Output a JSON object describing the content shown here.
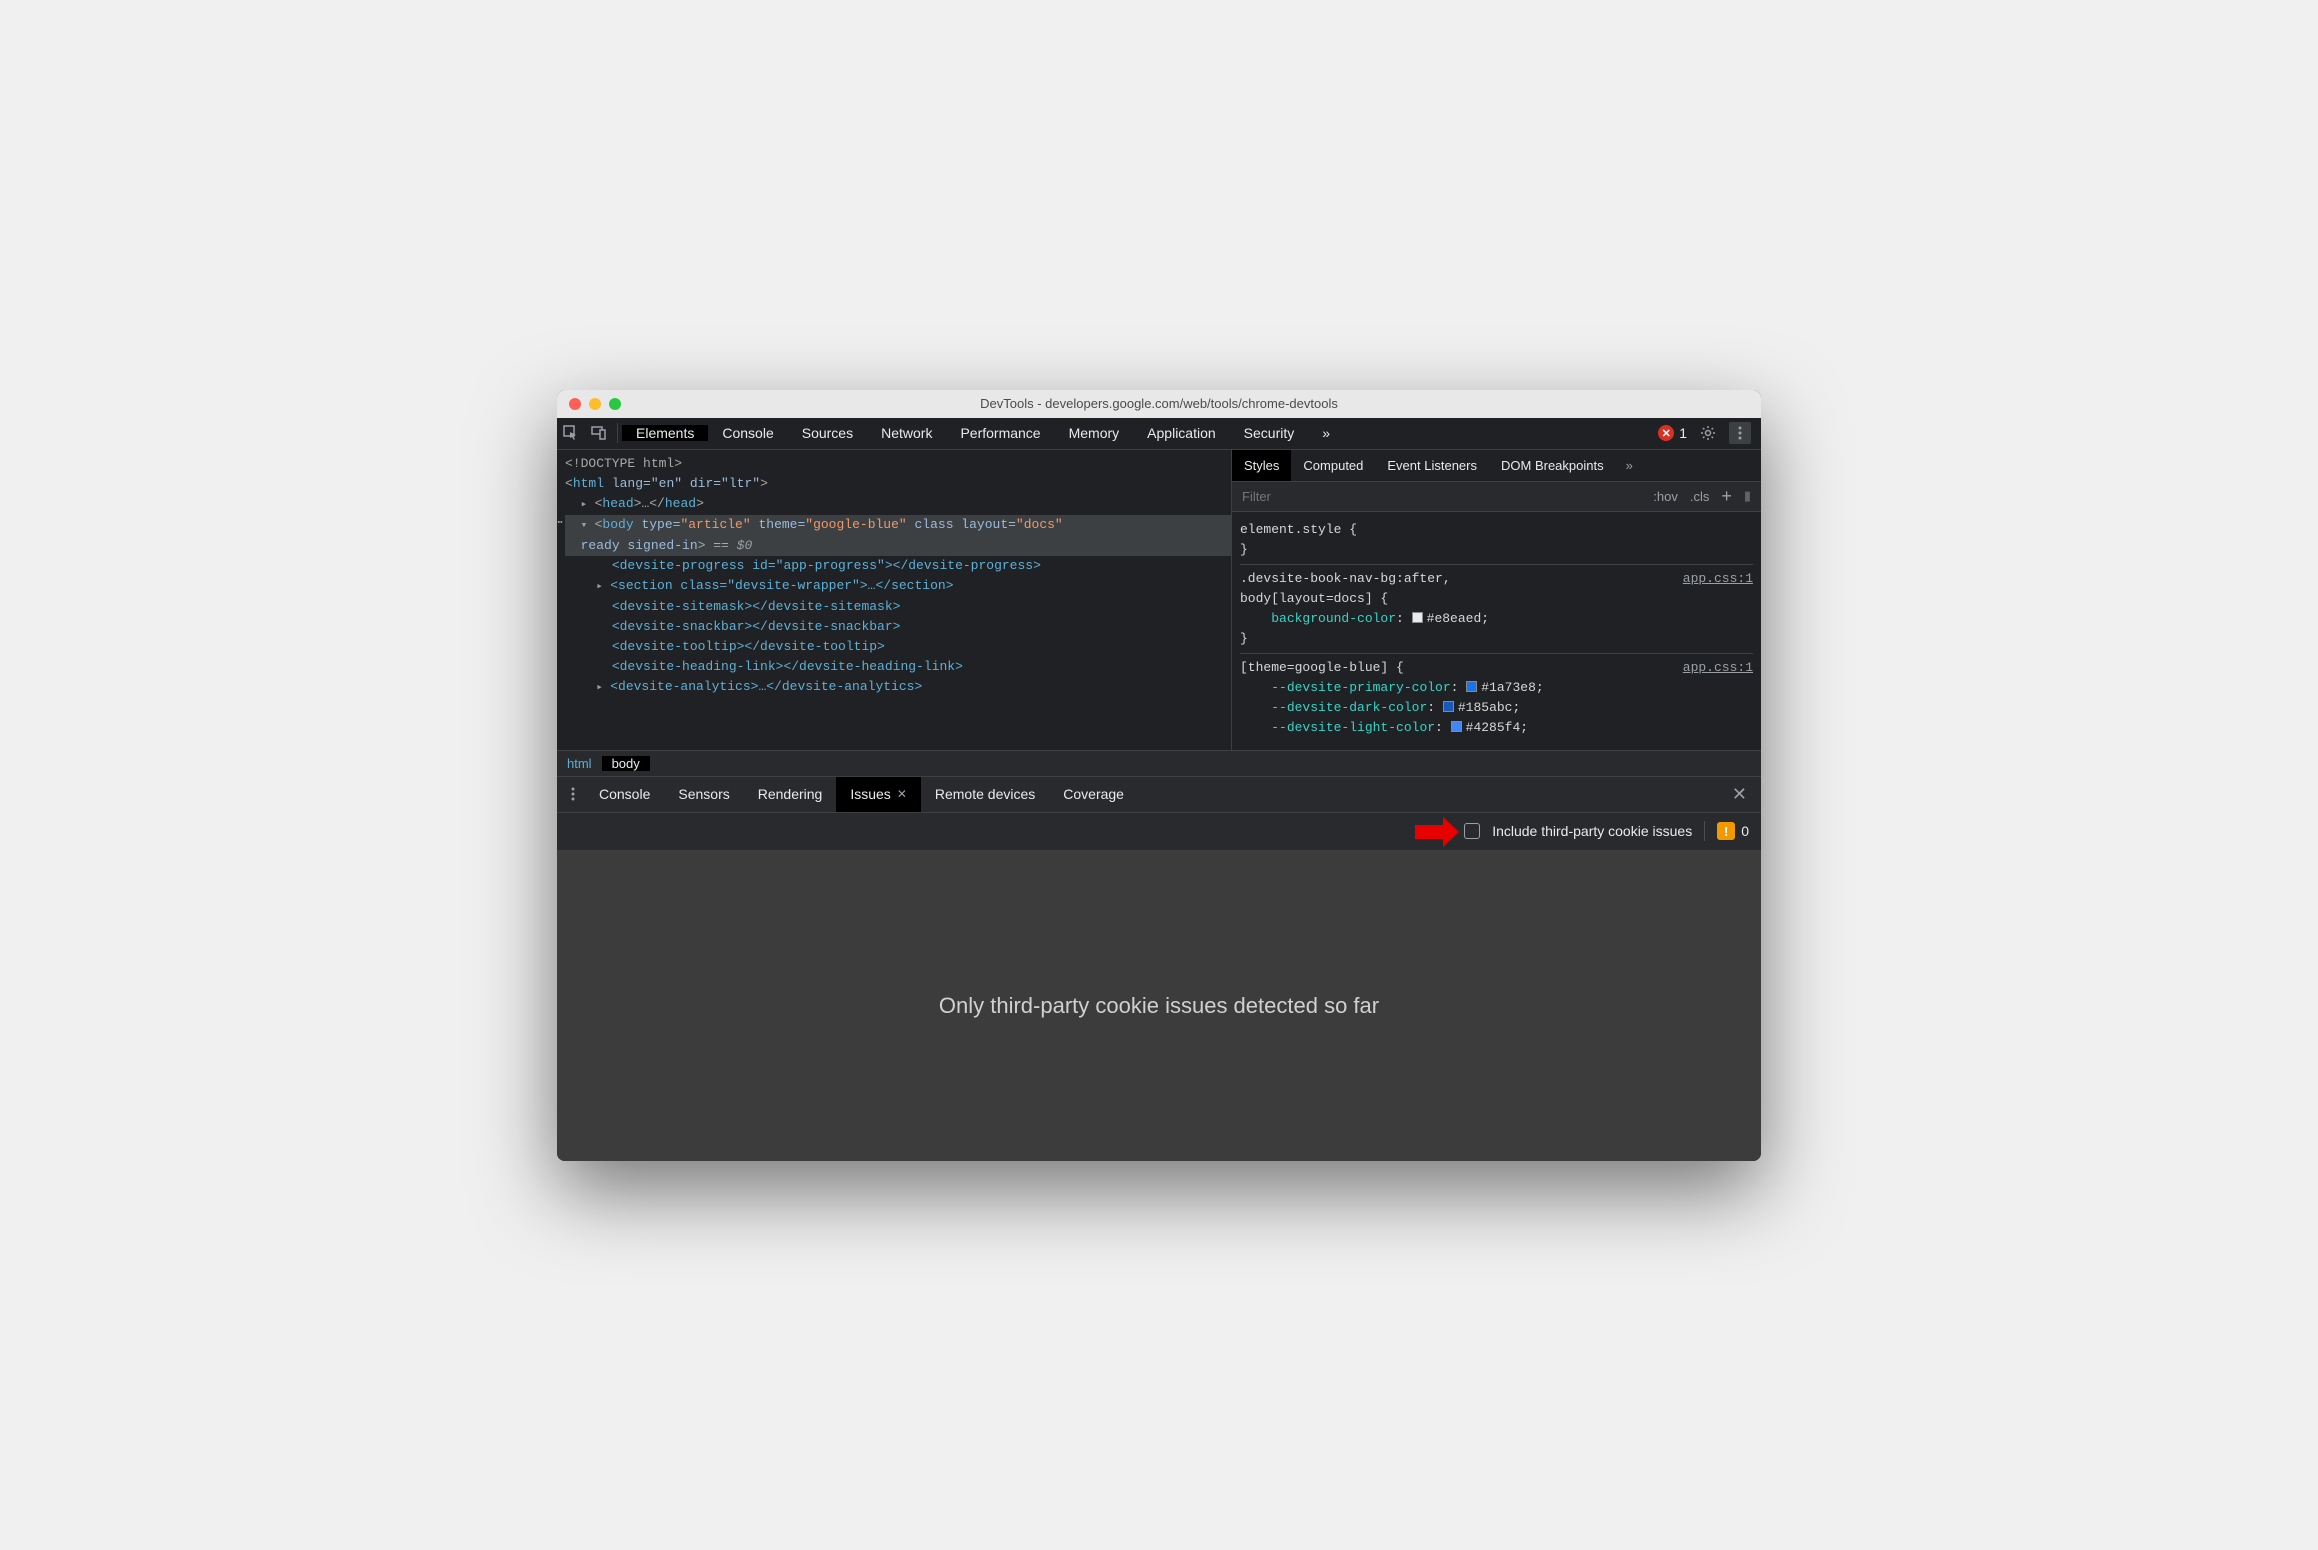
{
  "window": {
    "title": "DevTools - developers.google.com/web/tools/chrome-devtools"
  },
  "topbar": {
    "tabs": [
      "Elements",
      "Console",
      "Sources",
      "Network",
      "Performance",
      "Memory",
      "Application",
      "Security"
    ],
    "active": "Elements",
    "more_symbol": "»",
    "error_count": "1"
  },
  "elements": {
    "line0": "<!DOCTYPE html>",
    "line1_open": "<",
    "line1_tag": "html",
    "line1_attrs": " lang=\"en\" dir=\"ltr\"",
    "line1_close": ">",
    "line2_open": "<",
    "line2_tag": "head",
    "line2_mid": ">…</",
    "line2_tag2": "head",
    "line2_close": ">",
    "body_open": "<",
    "body_tag": "body",
    "body_attr1_name": " type=",
    "body_attr1_val": "\"article\"",
    "body_attr2_name": " theme=",
    "body_attr2_val": "\"google-blue\"",
    "body_attr3": " class layout=",
    "body_attr3_val": "\"docs\"",
    "body_line2": " ready signed-in",
    "body_eq": "> == ",
    "body_dollar": "$0",
    "child1": "<devsite-progress id=\"app-progress\"></devsite-progress>",
    "child2": "<section class=\"devsite-wrapper\">…</section>",
    "child3": "<devsite-sitemask></devsite-sitemask>",
    "child4": "<devsite-snackbar></devsite-snackbar>",
    "child5": "<devsite-tooltip></devsite-tooltip>",
    "child6": "<devsite-heading-link></devsite-heading-link>",
    "child7": "<devsite-analytics>…</devsite-analytics>"
  },
  "breadcrumb": {
    "items": [
      "html",
      "body"
    ],
    "active": "body"
  },
  "sidebar": {
    "tabs": [
      "Styles",
      "Computed",
      "Event Listeners",
      "DOM Breakpoints"
    ],
    "active": "Styles",
    "more_symbol": "»",
    "filter_placeholder": "Filter",
    "hov_label": ":hov",
    "cls_label": ".cls",
    "rule0": "element.style {",
    "rule0_close": "}",
    "rule1_sel": ".devsite-book-nav-bg:after,",
    "rule1_sel2": "body[layout=docs] {",
    "rule1_prop": "background-color",
    "rule1_val": "#e8eaed",
    "rule1_close": "}",
    "rule1_link": "app.css:1",
    "rule2_sel": "[theme=google-blue] {",
    "rule2_p1": "--devsite-primary-color",
    "rule2_v1": "#1a73e8",
    "rule2_p2": "--devsite-dark-color",
    "rule2_v2": "#185abc",
    "rule2_p3": "--devsite-light-color",
    "rule2_v3": "#4285f4",
    "rule2_link": "app.css:1"
  },
  "drawer": {
    "tabs": [
      "Console",
      "Sensors",
      "Rendering",
      "Issues",
      "Remote devices",
      "Coverage"
    ],
    "active": "Issues",
    "include_label": "Include third-party cookie issues",
    "warn_count": "0",
    "empty_msg": "Only third-party cookie issues detected so far"
  }
}
